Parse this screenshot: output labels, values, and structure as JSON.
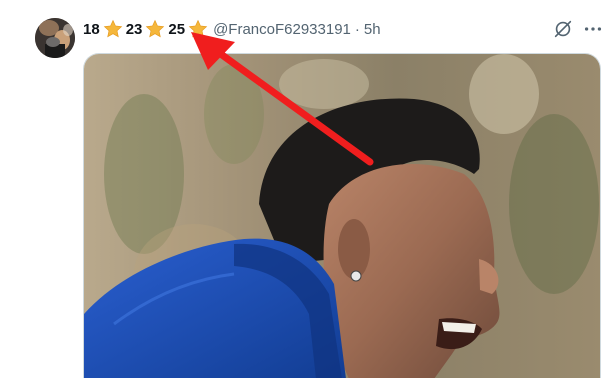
{
  "tweet": {
    "display_name": {
      "num1": "18",
      "num2": "23",
      "num3": "25",
      "badge_icon": "star-emoji"
    },
    "handle": "@FrancoF62933191",
    "separator": "·",
    "time": "5h",
    "actions": {
      "grok_icon": "grok-icon",
      "more_icon": "more-dots-icon"
    },
    "media": {
      "subject": "photo"
    }
  },
  "colors": {
    "text_primary": "#0f1419",
    "text_secondary": "#536471",
    "star": "#f5b73b",
    "annotation_arrow": "#f01e1e",
    "shirt": "#1c4fb8"
  }
}
